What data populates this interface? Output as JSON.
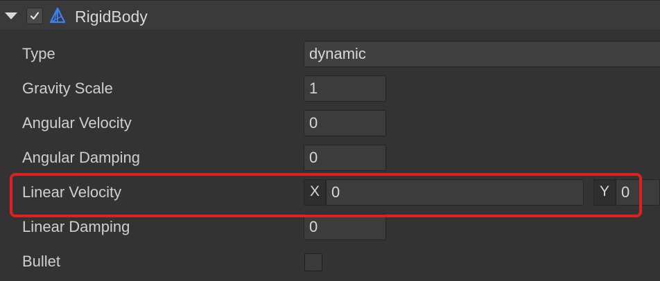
{
  "component": {
    "title": "RigidBody",
    "enabled": true,
    "icons": {
      "fold": "chevron-down-icon",
      "enable": "checkmark-icon",
      "component": "rigidbody-icon"
    },
    "accent_icon_color": "#3b82f6"
  },
  "properties": {
    "type": {
      "label": "Type",
      "value": "dynamic"
    },
    "gravity_scale": {
      "label": "Gravity Scale",
      "value": "1"
    },
    "angular_velocity": {
      "label": "Angular Velocity",
      "value": "0"
    },
    "angular_damping": {
      "label": "Angular Damping",
      "value": "0"
    },
    "linear_velocity": {
      "label": "Linear Velocity",
      "x_label": "X",
      "x_value": "0",
      "y_label": "Y",
      "y_value": "0"
    },
    "linear_damping": {
      "label": "Linear Damping",
      "value": "0"
    },
    "bullet": {
      "label": "Bullet",
      "checked": false
    }
  },
  "highlight_color": "#e02020"
}
